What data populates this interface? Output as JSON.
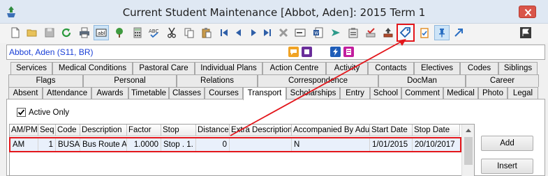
{
  "window": {
    "title": "Current Student Maintenance  [Abbot, Aden]:  2015 Term 1"
  },
  "toolbar": {
    "icons": [
      "new-document-icon",
      "open-folder-icon",
      "save-icon",
      "refresh-icon",
      "print-icon",
      "text-field-icon",
      "tree-icon",
      "calculator-icon",
      "spellcheck-icon",
      "cut-icon",
      "copy-icon",
      "paste-icon",
      "first-record-icon",
      "previous-record-icon",
      "next-record-icon",
      "last-record-icon",
      "delete-icon",
      "form-icon",
      "word-export-icon",
      "send-icon",
      "clipboard-icon",
      "approve-icon",
      "upload-icon",
      "tag-icon",
      "checklist-icon",
      "pin-icon",
      "expand-arrow-icon",
      "flag-icon"
    ]
  },
  "student": {
    "name": "Abbot, Aden (S11, BR)"
  },
  "tabs": {
    "row1": [
      "Services",
      "Medical Conditions",
      "Pastoral Care",
      "Individual Plans",
      "Action Centre",
      "Activity",
      "Contacts",
      "Electives",
      "Codes",
      "Siblings"
    ],
    "row2": [
      "Flags",
      "Personal",
      "Relations",
      "Correspondence",
      "DocMan",
      "Career"
    ],
    "row3": [
      "Absent",
      "Attendance",
      "Awards",
      "Timetable",
      "Classes",
      "Courses",
      "Transport",
      "Scholarships",
      "Entry",
      "School",
      "Comment",
      "Medical",
      "Photo",
      "Legal"
    ],
    "active": "Transport"
  },
  "filter": {
    "active_only_label": "Active Only",
    "active_only_checked": true
  },
  "grid": {
    "columns": [
      "AM/PM",
      "Seq",
      "Code",
      "Description",
      "Factor",
      "Stop",
      "Distance",
      "Extra Description",
      "Accompanied By Adult",
      "Start Date",
      "Stop Date"
    ],
    "rows": [
      {
        "am_pm": "AM",
        "seq": "1",
        "code": "BUSA",
        "description": "Bus Route A",
        "factor": "1.0000",
        "stop": "Stop . 1.",
        "distance": "0",
        "extra_description": "",
        "accompanied": "N",
        "start_date": "1/01/2015",
        "stop_date": "20/10/2017"
      }
    ]
  },
  "buttons": {
    "add": "Add",
    "insert": "Insert"
  },
  "colors": {
    "highlight": "#e3161b",
    "student_name": "#1a3fd6"
  }
}
